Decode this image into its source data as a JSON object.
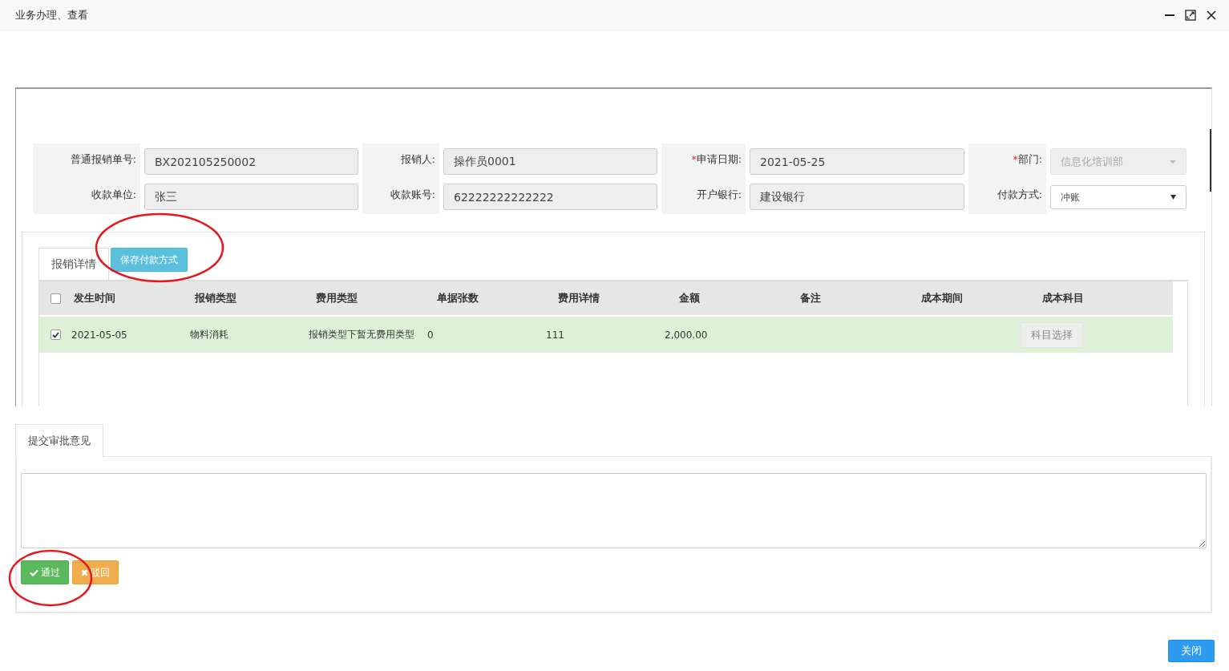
{
  "window": {
    "title": "业务办理、查看"
  },
  "form": {
    "fields": [
      {
        "label": "普通报销单号:",
        "kind": "readonly",
        "value": "BX202105250002"
      },
      {
        "label": "报销人:",
        "kind": "readonly",
        "value": "操作员0001"
      },
      {
        "required_mark": "*",
        "label": "申请日期:",
        "kind": "readonly",
        "value": "2021-05-25"
      },
      {
        "required_mark": "*",
        "label": "部门:",
        "kind": "disabled-select",
        "value": "信息化培训部"
      },
      {
        "label": "收款单位:",
        "kind": "readonly",
        "value": "张三"
      },
      {
        "label": "收款账号:",
        "kind": "readonly",
        "value": "62222222222222"
      },
      {
        "label": "开户银行:",
        "kind": "readonly",
        "value": "建设银行"
      },
      {
        "label": "付款方式:",
        "kind": "select",
        "value": "冲账"
      }
    ]
  },
  "detail_tabs": [
    {
      "label": "报销详情",
      "selected": true
    }
  ],
  "save_button": "保存付款方式",
  "table": {
    "select_all_checked": false,
    "columns": [
      "发生时间",
      "报销类型",
      "费用类型",
      "单据张数",
      "费用详情",
      "金额",
      "备注",
      "成本期间",
      "成本科目"
    ],
    "rows": [
      {
        "checked": true,
        "selected": true,
        "cells": [
          "2021-05-05",
          "物料消耗",
          "报销类型下暂无费用类型",
          "0",
          "111",
          "2,000.00",
          "",
          ""
        ],
        "action": "科目选择"
      }
    ]
  },
  "approval": {
    "tab": {
      "label": "提交审批意见",
      "selected": true
    },
    "buttons": [
      {
        "kind": "approve",
        "label": "通过"
      },
      {
        "kind": "reject",
        "label": "驳回"
      }
    ]
  },
  "close_button": "关闭"
}
